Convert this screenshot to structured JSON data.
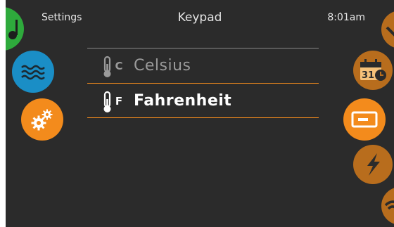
{
  "header": {
    "left_label": "Settings",
    "title": "Keypad",
    "time": "8:01am"
  },
  "options": [
    {
      "unit_letter": "C",
      "label": "Celsius",
      "selected": false,
      "icon": "thermometer-icon"
    },
    {
      "unit_letter": "F",
      "label": "Fahrenheit",
      "selected": true,
      "icon": "thermometer-icon"
    }
  ],
  "left_nav": [
    {
      "name": "music",
      "icon": "music-note-icon",
      "color": "#2eaa3c"
    },
    {
      "name": "water",
      "icon": "water-waves-icon",
      "color": "#1a8ec6"
    },
    {
      "name": "settings",
      "icon": "gears-icon",
      "color": "#f38b1c"
    }
  ],
  "right_nav": [
    {
      "name": "dropdown",
      "icon": "chevron-down-icon",
      "color": "#b86d1d"
    },
    {
      "name": "calendar",
      "icon": "calendar-icon",
      "calendar_day": "31",
      "color": "#b86d1d"
    },
    {
      "name": "keypad",
      "icon": "keypad-icon",
      "color": "#f38b1c"
    },
    {
      "name": "power",
      "icon": "lightning-icon",
      "color": "#b86d1d"
    },
    {
      "name": "wifi",
      "icon": "wifi-icon",
      "color": "#b86d1d"
    }
  ],
  "colors": {
    "accent": "#f38b1c",
    "selected_text": "#ffffff",
    "unselected_text": "#9a9a9a",
    "background": "#2b2b2b"
  }
}
